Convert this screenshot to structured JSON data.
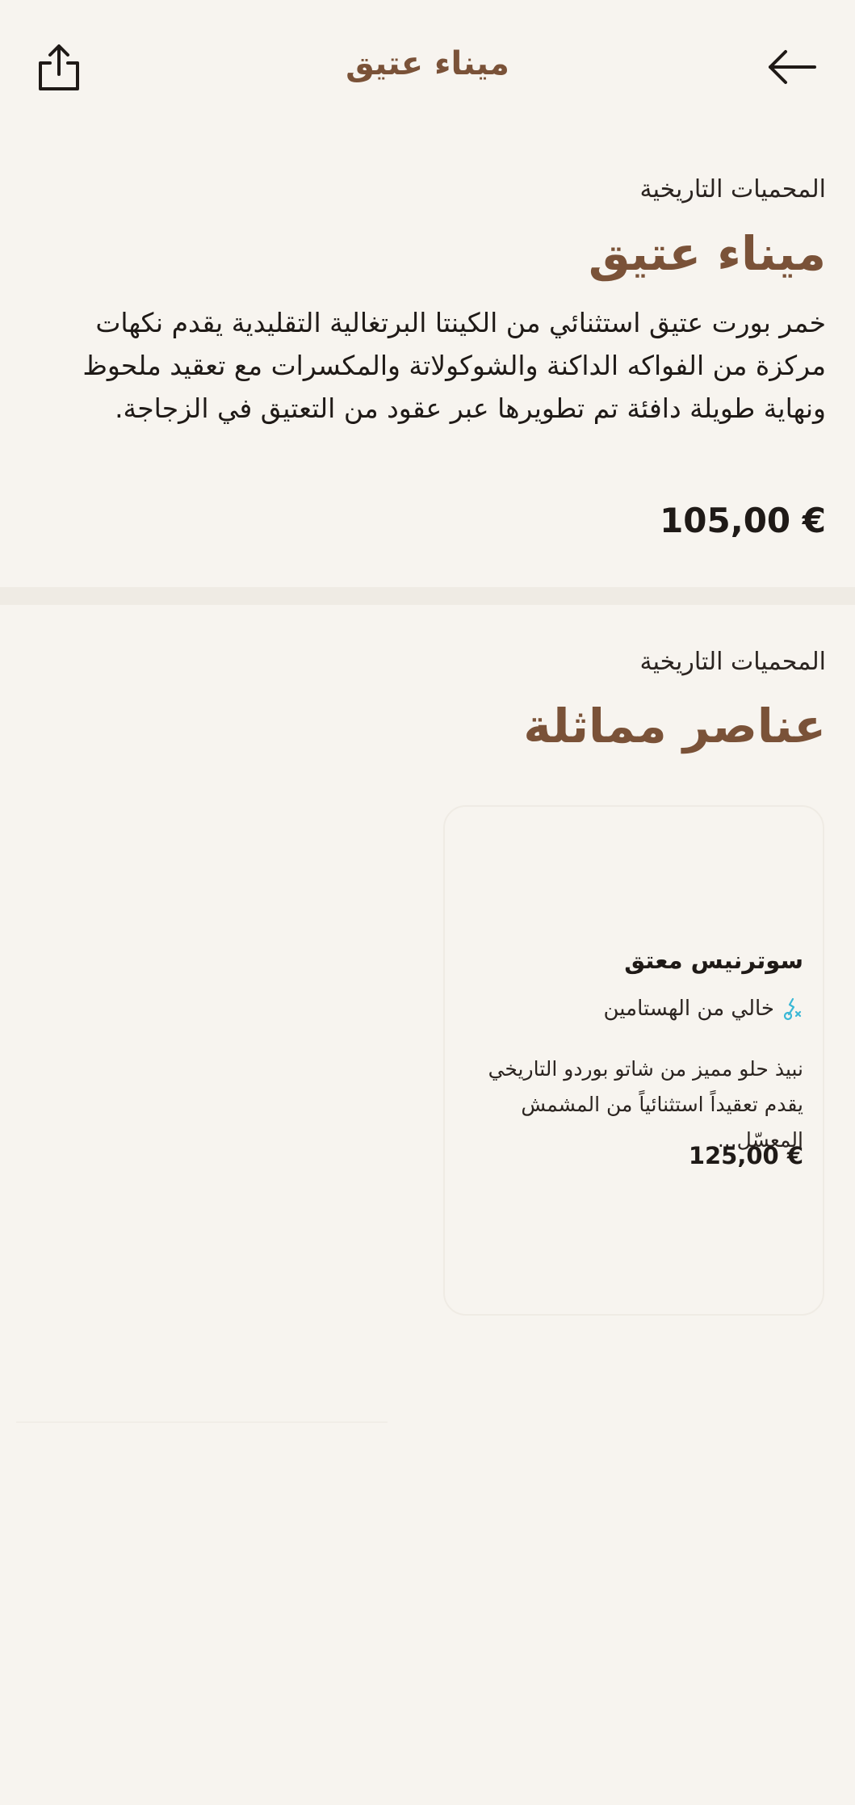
{
  "header": {
    "title": "ميناء عتيق",
    "share_icon": "share-icon",
    "back_icon": "arrow-left-icon"
  },
  "product": {
    "category": "المحميات التاريخية",
    "title": "ميناء عتيق",
    "description": "خمر بورت عتيق استثنائي من الكينتا البرتغالية التقليدية يقدم نكهات مركزة من الفواكه الداكنة والشوكولاتة والمكسرات مع تعقيد ملحوظ ونهاية طويلة دافئة تم تطويرها عبر عقود من التعتيق في الزجاجة.",
    "price": "105,00 €"
  },
  "similar": {
    "category": "المحميات التاريخية",
    "title": "عناصر مماثلة",
    "items": [
      {
        "name": "سوترنيس معتق",
        "badge": "خالي من الهستامين",
        "badge_icon": "histamine-free-icon",
        "description": "نبيذ حلو مميز من شاتو بوردو التاريخي يقدم تعقيداً استثنائياً من المشمش المعسّل...",
        "price": "125,00 €"
      }
    ]
  },
  "colors": {
    "background": "#f7f4ef",
    "accent": "#7a5238",
    "text": "#1f1a17",
    "badge_icon": "#3bb8d6"
  }
}
